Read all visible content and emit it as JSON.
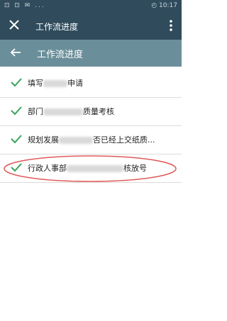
{
  "status_bar": {
    "left": "⊡ ⊡ ✉ ...",
    "right": "◴ 10:17"
  },
  "app_bar": {
    "title": "工作流进度"
  },
  "header": {
    "title": "工作流进度"
  },
  "steps": [
    {
      "prefix": "填写",
      "suffix": "申请"
    },
    {
      "prefix": "部门",
      "suffix": "质量考核"
    },
    {
      "prefix": "规划发展",
      "suffix": "否已经上交纸质..."
    },
    {
      "prefix": "行政人事部",
      "suffix": "核放号"
    }
  ],
  "colors": {
    "app_bar": "#2f4b5c",
    "header": "#6b8f9a",
    "check": "#3aa35b",
    "highlight": "#e05a5a"
  }
}
